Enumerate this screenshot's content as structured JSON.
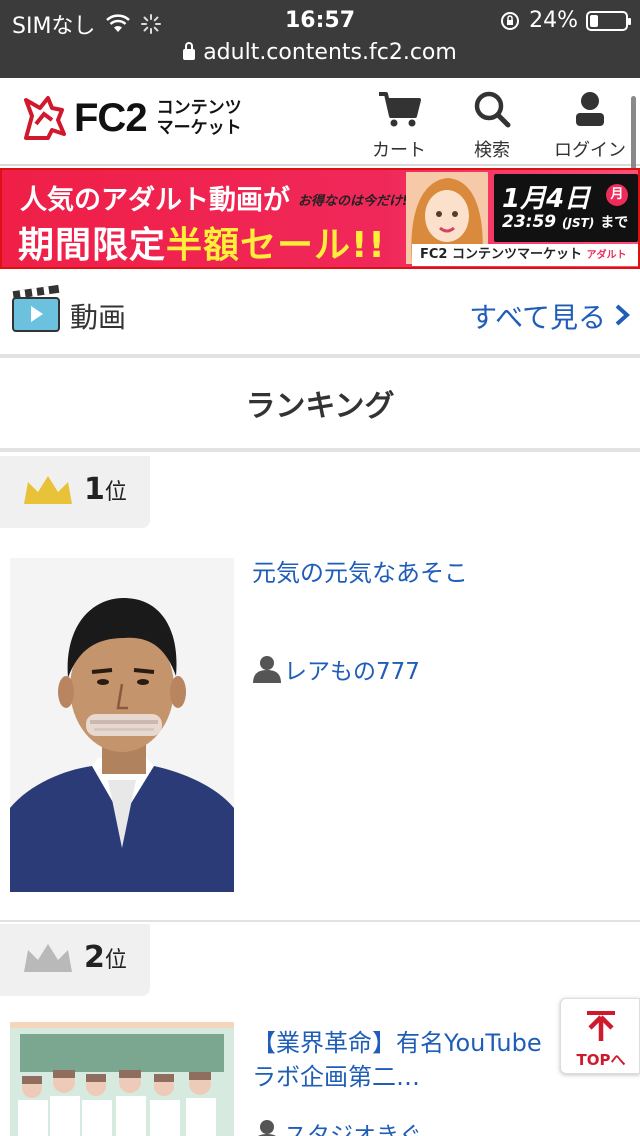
{
  "status_bar": {
    "carrier": "SIMなし",
    "time": "16:57",
    "battery_percent": "24%",
    "battery_level": 0.24,
    "url": "adult.contents.fc2.com"
  },
  "header": {
    "logo_text": "FC2",
    "logo_sub_line1": "コンテンツ",
    "logo_sub_line2": "マーケット",
    "cart_label": "カート",
    "search_label": "検索",
    "login_label": "ログイン"
  },
  "banner": {
    "line1": "人気のアダルト動画が",
    "line2_white": "期間限定",
    "line2_yellow": "半額セール!!",
    "tagline": "お得なのは今だけ!!",
    "date": "1月4日",
    "weekday": "月",
    "time": "23:59",
    "timezone": "(JST)",
    "until": "まで",
    "footer_brand": "FC2 コンテンツマーケット",
    "footer_tag": "アダルト"
  },
  "section": {
    "title": "動画",
    "see_all": "すべて見る"
  },
  "ranking": {
    "title": "ランキング",
    "items": [
      {
        "rank": "1",
        "rank_suffix": "位",
        "title": "元気の元気なあそこ",
        "seller": "レアもの777"
      },
      {
        "rank": "2",
        "rank_suffix": "位",
        "title_line1": "【業界革命】有名YouTube",
        "title_line2": "ラボ企画第二…",
        "seller": "スタジオきぐ"
      }
    ]
  },
  "top_button": {
    "label": "TOPへ"
  },
  "colors": {
    "accent_red": "#d0192c",
    "link_blue": "#1f5db8",
    "banner_pink": "#ef1f47",
    "gold_crown": "#e8c33a",
    "silver_crown": "#b9b9b9"
  }
}
